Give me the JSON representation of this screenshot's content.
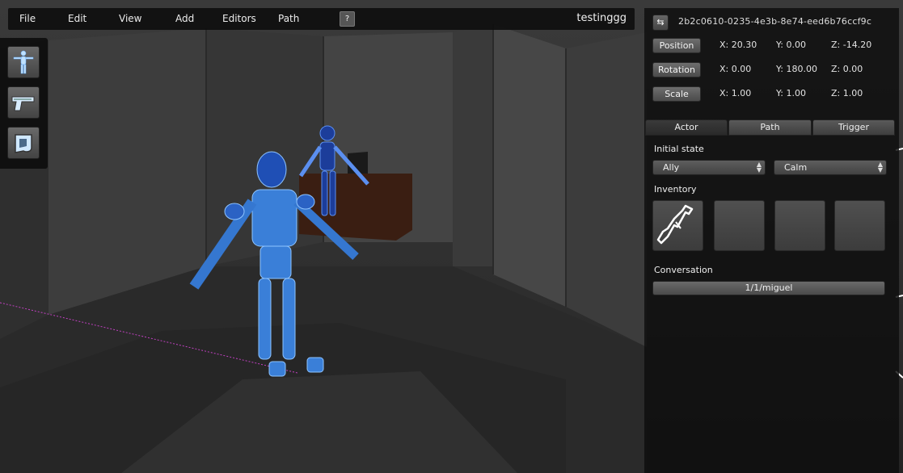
{
  "menubar": {
    "items": [
      "File",
      "Edit",
      "View",
      "Add",
      "Editors",
      "Path"
    ],
    "help_label": "?",
    "project_title": "testinggg"
  },
  "toolbox": {
    "tools": [
      "actor-icon",
      "pistol-icon",
      "item-icon"
    ]
  },
  "inspector": {
    "refresh_icon": "refresh-icon",
    "guid": "2b2c0610-0235-4e3b-8e74-eed6b76ccf9c",
    "position": {
      "label": "Position",
      "x": "X: 20.30",
      "y": "Y: 0.00",
      "z": "Z: -14.20"
    },
    "rotation": {
      "label": "Rotation",
      "x": "X: 0.00",
      "y": "Y: 180.00",
      "z": "Z: 0.00"
    },
    "scale": {
      "label": "Scale",
      "x": "X: 1.00",
      "y": "Y: 1.00",
      "z": "Z: 1.00"
    },
    "tabs": [
      {
        "label": "Actor",
        "active": true
      },
      {
        "label": "Path",
        "active": false
      },
      {
        "label": "Trigger",
        "active": false
      }
    ],
    "initial_state_label": "Initial state",
    "faction_value": "Ally",
    "mood_value": "Calm",
    "inventory_label": "Inventory",
    "inventory_slots": [
      "rifle-icon",
      "",
      "",
      ""
    ],
    "conversation_label": "Conversation",
    "conversation_value": "1/1/miguel"
  },
  "colors": {
    "panel_bg": "#0e0e0e",
    "accent_blue": "#3f8fe0",
    "path_line": "#c040c0"
  }
}
